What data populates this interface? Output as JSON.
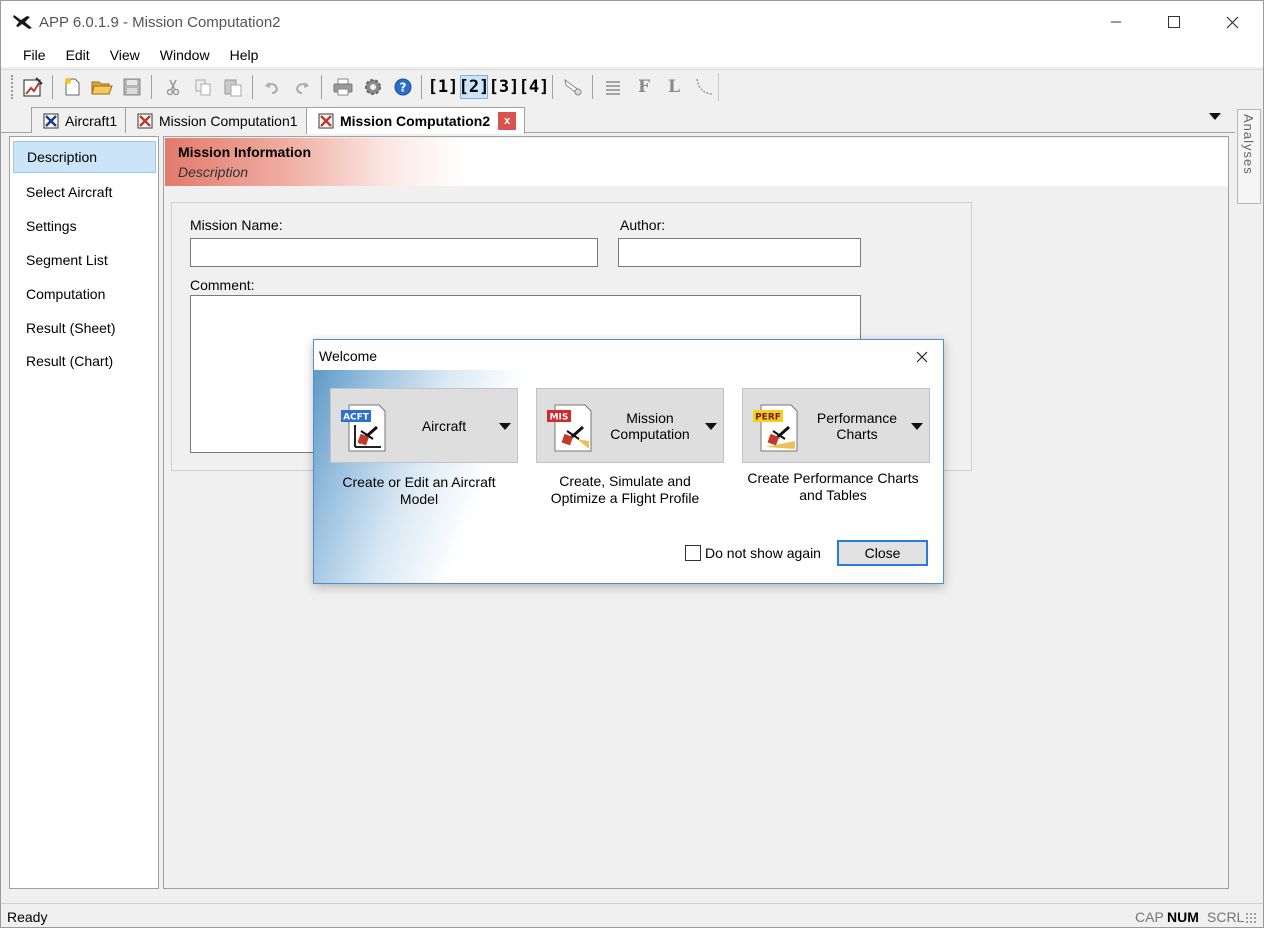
{
  "window": {
    "title": "APP 6.0.1.9 - Mission Computation2"
  },
  "menu": [
    "File",
    "Edit",
    "View",
    "Window",
    "Help"
  ],
  "toolbar": {
    "views": [
      "[1]",
      "[2]",
      "[3]",
      "[4]"
    ],
    "active_view": "[2]",
    "letters": [
      "F",
      "L"
    ]
  },
  "tabs": [
    {
      "label": "Aircraft1"
    },
    {
      "label": "Mission Computation1"
    },
    {
      "label": "Mission Computation2",
      "close": "x"
    }
  ],
  "side_panel": {
    "label": "Analyses"
  },
  "nav": [
    "Description",
    "Select Aircraft",
    "Settings",
    "Segment List",
    "Computation",
    "Result (Sheet)",
    "Result (Chart)"
  ],
  "section": {
    "title": "Mission Information",
    "subtitle": "Description"
  },
  "form": {
    "mission_name_label": "Mission Name:",
    "mission_name_value": "",
    "author_label": "Author:",
    "author_value": "",
    "comment_label": "Comment:",
    "comment_value": ""
  },
  "dialog": {
    "title": "Welcome",
    "buttons": [
      {
        "badge": "ACFT",
        "label": "Aircraft",
        "description": "Create or Edit an Aircraft Model"
      },
      {
        "badge": "MIS",
        "label": "Mission Computation",
        "description": "Create, Simulate and Optimize a Flight Profile"
      },
      {
        "badge": "PERF",
        "label": "Performance Charts",
        "description": "Create Performance Charts and Tables"
      }
    ],
    "do_not_show_label": "Do not show again",
    "close_label": "Close"
  },
  "status": {
    "text": "Ready",
    "indicators": [
      "CAP",
      "NUM",
      "SCRL"
    ],
    "active_indicator": "NUM"
  },
  "colors": {
    "accent_blue": "#2b7cd3",
    "selection": "#cce4f7",
    "header_red": "#e27a6c",
    "tab_close": "#d9534f"
  }
}
